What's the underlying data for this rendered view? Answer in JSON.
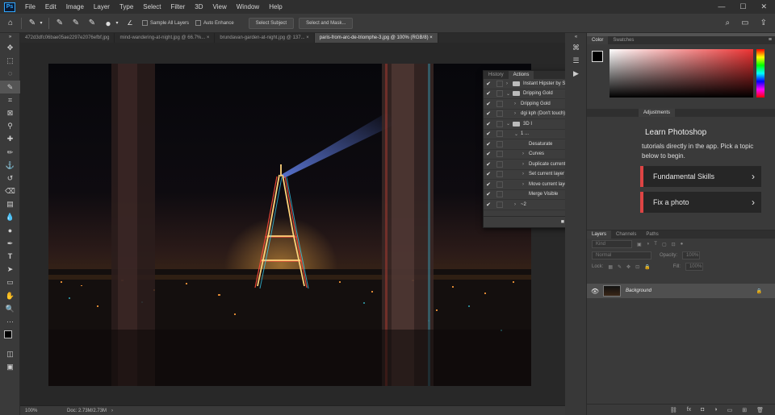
{
  "menu": [
    "File",
    "Edit",
    "Image",
    "Layer",
    "Type",
    "Select",
    "Filter",
    "3D",
    "View",
    "Window",
    "Help"
  ],
  "options": {
    "sample_all_layers": "Sample All Layers",
    "auto_enhance": "Auto Enhance",
    "select_subject": "Select Subject",
    "select_and_mask": "Select and Mask..."
  },
  "tabs": [
    {
      "label": "472d3dfc06bae05ae2297e2076efbf.jpg",
      "active": false
    },
    {
      "label": "mind-wandering-at-night.jpg @ 66.7%... ×",
      "active": false
    },
    {
      "label": "brundavan-garden-at-night.jpg @ 137... ×",
      "active": false
    },
    {
      "label": "paris-from-arc-de-triomphe-3.jpg @ 100% (RGB/8) ×",
      "active": true
    }
  ],
  "status": {
    "zoom": "100%",
    "doc": "Doc: 2.73M/2.73M"
  },
  "actions_panel": {
    "tabs": [
      "History",
      "Actions"
    ],
    "rows": [
      {
        "label": "Instant Hipster by SparkleStock",
        "check": "✔",
        "arrow": "›",
        "folder": true,
        "indent": 0
      },
      {
        "label": "Dripping Gold",
        "check": "✔",
        "arrow": "⌄",
        "folder": true,
        "indent": 0
      },
      {
        "label": "Dripping Gold",
        "check": "✔",
        "arrow": "›",
        "folder": false,
        "indent": 1
      },
      {
        "label": "dgi kph (Don't touch)",
        "check": "✔",
        "arrow": "›",
        "folder": false,
        "indent": 1
      },
      {
        "label": "3D I",
        "check": "✔",
        "arrow": "⌄",
        "folder": true,
        "indent": 0
      },
      {
        "label": "1 ...",
        "check": "✔",
        "arrow": "⌄",
        "folder": false,
        "indent": 1
      },
      {
        "label": "Desaturate",
        "check": "✔",
        "arrow": "",
        "folder": false,
        "indent": 2
      },
      {
        "label": "Curves",
        "check": "✔",
        "arrow": "›",
        "folder": false,
        "indent": 2
      },
      {
        "label": "Duplicate current layer",
        "check": "✔",
        "arrow": "›",
        "folder": false,
        "indent": 2
      },
      {
        "label": "Set current layer",
        "check": "✔",
        "arrow": "›",
        "folder": false,
        "indent": 2
      },
      {
        "label": "Move current layer",
        "check": "✔",
        "arrow": "›",
        "folder": false,
        "indent": 2
      },
      {
        "label": "Merge Visible",
        "check": "✔",
        "arrow": "",
        "folder": false,
        "indent": 2
      },
      {
        "label": "~2",
        "check": "✔",
        "arrow": "›",
        "folder": false,
        "indent": 1
      }
    ]
  },
  "color_panel": {
    "tabs": [
      "Color",
      "Swatches"
    ]
  },
  "learn_panel": {
    "tab": "Adjustments",
    "title": "Learn Photoshop",
    "desc": "tutorials directly in the app. Pick a topic below to begin.",
    "cards": [
      "Fundamental Skills",
      "Fix a photo"
    ]
  },
  "layers_panel": {
    "tabs": [
      "Layers",
      "Channels",
      "Paths"
    ],
    "kind": "Kind",
    "blend": "Normal",
    "opacity_label": "Opacity:",
    "opacity": "100%",
    "lock_label": "Lock:",
    "fill_label": "Fill:",
    "fill": "100%",
    "layer_name": "Background"
  }
}
